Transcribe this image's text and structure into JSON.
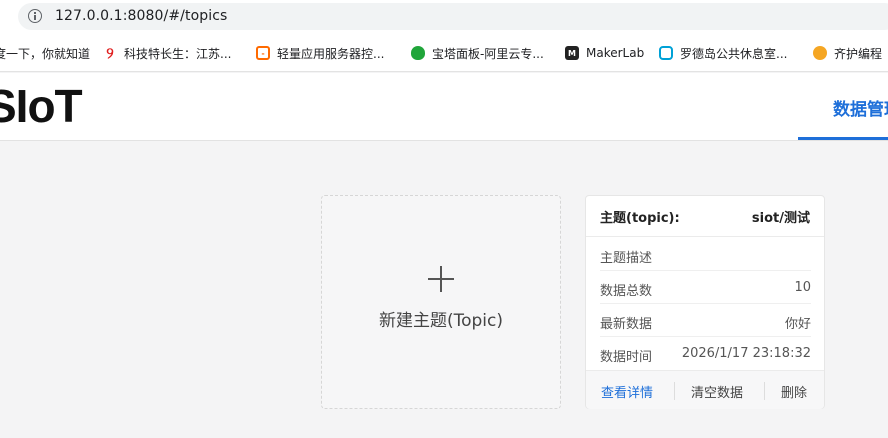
{
  "browser": {
    "url": "127.0.0.1:8080/#/topics"
  },
  "bookmarks": [
    {
      "label": "度一下，你就知道",
      "icon": "baidu-icon"
    },
    {
      "label": "科技特长生：江苏...",
      "icon": "swirl-icon",
      "color": "#e02020"
    },
    {
      "label": "轻量应用服务器控...",
      "icon": "aliyun-icon",
      "color": "#ff6a00"
    },
    {
      "label": "宝塔面板-阿里云专...",
      "icon": "bt-shield-icon",
      "color": "#20a53a"
    },
    {
      "label": "MakerLab",
      "icon": "makerlab-icon"
    },
    {
      "label": "罗德岛公共休息室...",
      "icon": "bilibili-icon",
      "color": "#00a1d6"
    },
    {
      "label": "齐护编程",
      "icon": "qihu-icon",
      "color": "#f5a623"
    }
  ],
  "header": {
    "logo": "SIoT",
    "nav_tab": "数据管理"
  },
  "new_topic": {
    "label": "新建主题(Topic)"
  },
  "topic_card": {
    "head_label": "主题(topic):",
    "head_value": "siot/测试",
    "rows": [
      {
        "key": "主题描述",
        "value": ""
      },
      {
        "key": "数据总数",
        "value": "10"
      },
      {
        "key": "最新数据",
        "value": "你好"
      },
      {
        "key": "数据时间",
        "value": "2026/1/17 23:18:32"
      }
    ],
    "actions": {
      "view": "查看详情",
      "clear": "清空数据",
      "delete": "删除"
    }
  },
  "colors": {
    "accent": "#1e6fd9"
  }
}
